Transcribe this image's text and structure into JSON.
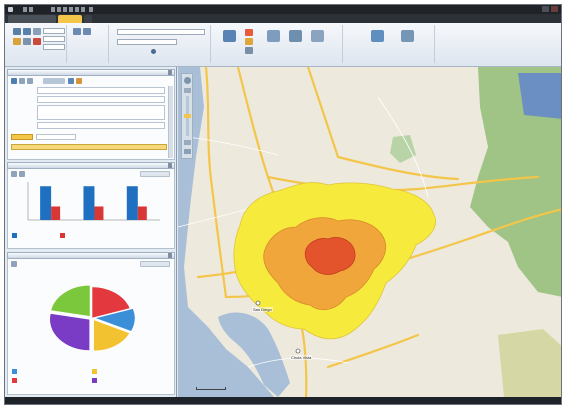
{
  "window": {
    "title": "",
    "tabs": [
      {
        "label": "",
        "active": false
      },
      {
        "label": "",
        "active": true
      }
    ]
  },
  "ribbon": {
    "address": "",
    "search": ""
  },
  "left_panel": {
    "sections": [
      {
        "title": ""
      },
      {
        "title": ""
      },
      {
        "title": ""
      }
    ],
    "form": {
      "rows": [
        {
          "label": "",
          "value": ""
        },
        {
          "label": "",
          "value": ""
        },
        {
          "label": "",
          "value": ""
        },
        {
          "label": "",
          "value": ""
        }
      ]
    },
    "bar_chart_legend": [
      {
        "label": "",
        "color": "#1f70c1"
      },
      {
        "label": "",
        "color": "#d93636"
      }
    ],
    "pie_legend": [
      {
        "label": "",
        "color": "#3b8fd9"
      },
      {
        "label": "",
        "color": "#f2c230"
      },
      {
        "label": "",
        "color": "#e4383f"
      },
      {
        "label": "",
        "color": "#7a3cc4"
      }
    ]
  },
  "chart_data": [
    {
      "type": "bar",
      "categories": [
        "",
        "",
        ""
      ],
      "series": [
        {
          "values": [
            4,
            4,
            4
          ],
          "color": "#1f70c1"
        },
        {
          "values": [
            1.6,
            1.6,
            1.6
          ],
          "color": "#d93636"
        }
      ],
      "ylim": [
        0,
        4.5
      ]
    },
    {
      "type": "pie",
      "slices": [
        {
          "value": 20,
          "color": "#e4383f"
        },
        {
          "value": 12,
          "color": "#3b8fd9"
        },
        {
          "value": 18,
          "color": "#f2c230"
        },
        {
          "value": 28,
          "color": "#7a3cc4"
        },
        {
          "value": 22,
          "color": "#7cc83c"
        }
      ]
    }
  ],
  "map": {
    "labels": {
      "san_diego": "San Diego",
      "chula_vista": "Chula Vista"
    },
    "colors": {
      "water": "#a9bfd8",
      "land": "#eee9dd",
      "park": "#9fc486",
      "road": "#f3c64a",
      "zone1": "#f6ea3c",
      "zone2": "#f0a63a",
      "zone3": "#e4542c"
    }
  },
  "status_bar": {
    "items": [
      "",
      "",
      "",
      ""
    ]
  }
}
